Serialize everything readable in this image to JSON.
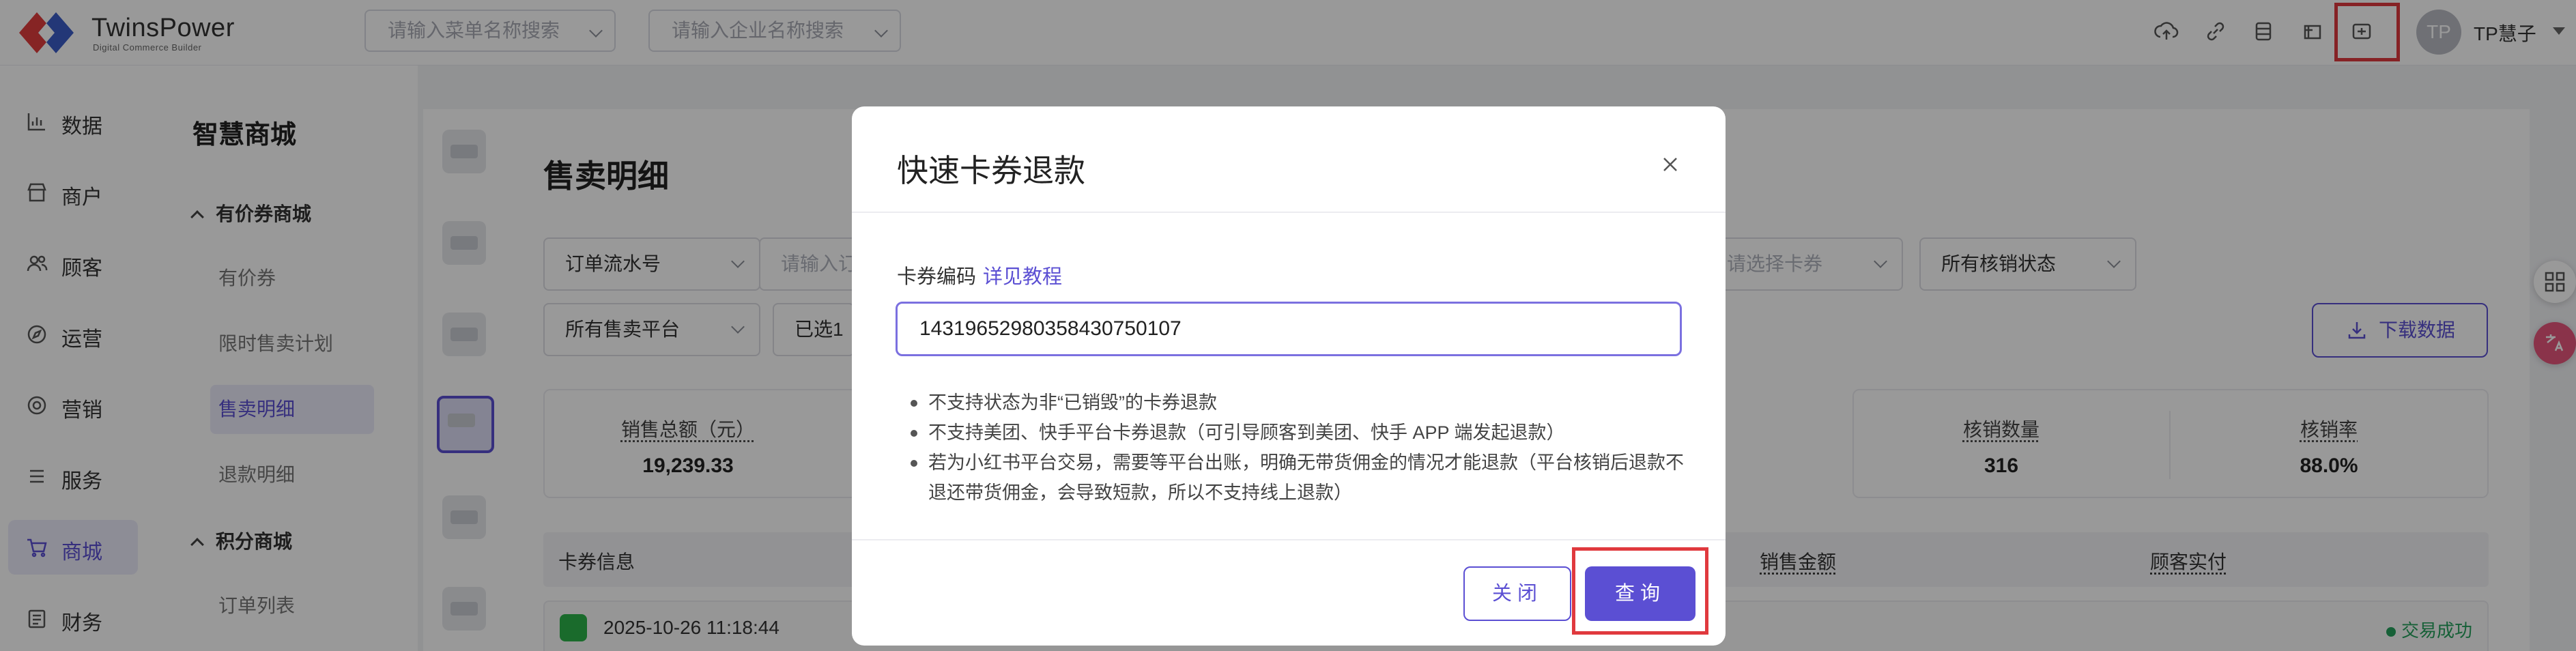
{
  "header": {
    "logo_name": "TwinsPower",
    "logo_sub": "Digital Commerce Builder",
    "menu_search_placeholder": "请输入菜单名称搜索",
    "company_search_placeholder": "请输入企业名称搜索",
    "icons": [
      "cloud-upload-icon",
      "link-icon",
      "database-icon",
      "gift-icon",
      "voucher-icon"
    ],
    "avatar_text": "TP",
    "user_name": "TP慧子",
    "accent": "#5b4fd3",
    "highlight": "#e0393e"
  },
  "sidebar": {
    "items": [
      {
        "label": "数据",
        "icon": "chart-icon"
      },
      {
        "label": "商户",
        "icon": "store-icon"
      },
      {
        "label": "顾客",
        "icon": "customers-icon"
      },
      {
        "label": "运营",
        "icon": "compass-icon"
      },
      {
        "label": "营销",
        "icon": "marketing-icon"
      },
      {
        "label": "服务",
        "icon": "list-icon"
      },
      {
        "label": "商城",
        "icon": "cart-icon"
      },
      {
        "label": "财务",
        "icon": "finance-icon"
      }
    ]
  },
  "subside": {
    "title": "智慧商城",
    "group1": "有价券商城",
    "group1_items": [
      "有价券",
      "限时售卖计划",
      "售卖明细",
      "退款明细"
    ],
    "group2": "积分商城",
    "group2_items": [
      "订单列表"
    ]
  },
  "main": {
    "page_title": "售卖明细",
    "filter_order_type": "订单流水号",
    "filter_order_input_placeholder": "请输入订",
    "filter_coupon_placeholder": "请选择卡券",
    "filter_verify_status": "所有核销状态",
    "filter_platform": "所有售卖平台",
    "filter_selected": "已选1",
    "download_label": "下载数据",
    "stats": [
      {
        "label": "销售总额（元）",
        "value": "19,239.33"
      },
      {
        "label": "核销数量",
        "value": "316"
      },
      {
        "label": "核销率",
        "value": "88.0%"
      }
    ],
    "table_headers": [
      "卡券信息",
      "销售金额",
      "顾客实付"
    ],
    "row_time": "2025-10-26 11:18:44",
    "row_status": "交易成功"
  },
  "modal": {
    "title": "快速卡券退款",
    "code_label": "卡券编码",
    "tutorial_link": "详见教程",
    "code_value": "1431965298035843075​0107",
    "notes": [
      "不支持状态为非“已销毁”的卡券退款",
      "不支持美团、快手平台卡券退款（可引导顾客到美团、快手 APP 端发起退款）",
      "若为小红书平台交易，需要等平台出账，明确无带货佣金的情况才能退款（平台核销后退款不退还带货佣金，会导致短款，所以不支持线上退款）"
    ],
    "close_label": "关闭",
    "query_label": "查询"
  }
}
